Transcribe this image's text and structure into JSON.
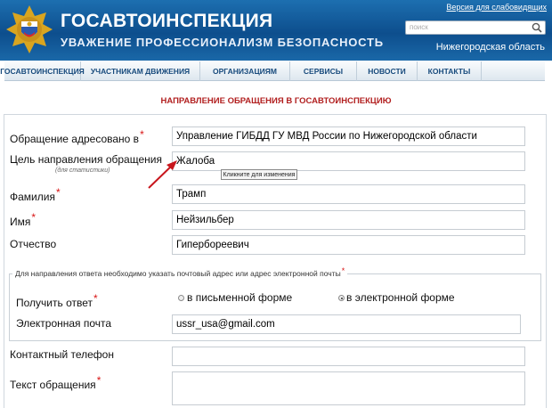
{
  "header": {
    "title": "ГОСАВТОИНСПЕКЦИЯ",
    "slogan": "УВАЖЕНИЕ ПРОФЕССИОНАЛИЗМ БЕЗОПАСНОСТЬ",
    "vision_link": "Версия для слабовидящих",
    "search_placeholder": "поиск",
    "region": "Нижегородская область"
  },
  "nav": {
    "items": [
      "ГОСАВТОИНСПЕКЦИЯ",
      "УЧАСТНИКАМ ДВИЖЕНИЯ",
      "ОРГАНИЗАЦИЯМ",
      "СЕРВИСЫ",
      "НОВОСТИ",
      "КОНТАКТЫ"
    ]
  },
  "form": {
    "title": "НАПРАВЛЕНИЕ ОБРАЩЕНИЯ В ГОСАВТОИНСПЕКЦИЮ",
    "addressed_label": "Обращение адресовано в",
    "addressed_value": "Управление ГИБДД ГУ МВД России по Нижегородской области",
    "purpose_label": "Цель направления обращения",
    "purpose_sublabel": "(для статистики)",
    "purpose_value": "Жалоба",
    "tooltip": "Кликните для изменения",
    "surname_label": "Фамилия",
    "surname_value": "Трамп",
    "name_label": "Имя",
    "name_value": "Нейзильбер",
    "patronymic_label": "Отчество",
    "patronymic_value": "Гипербореевич",
    "reply_legend": "Для направления ответа необходимо указать почтовый адрес или адрес электронной почты",
    "reply_label": "Получить ответ",
    "reply_option_written": "в письменной форме",
    "reply_option_email": "в электронной форме",
    "email_label": "Электронная почта",
    "email_value": "ussr_usa@gmail.com",
    "phone_label": "Контактный телефон",
    "text_label": "Текст обращения",
    "required_mark": "*"
  },
  "colors": {
    "header_blue": "#0d4e8d",
    "nav_text": "#174a7c",
    "title_red": "#b22020",
    "required_red": "#d81515"
  }
}
